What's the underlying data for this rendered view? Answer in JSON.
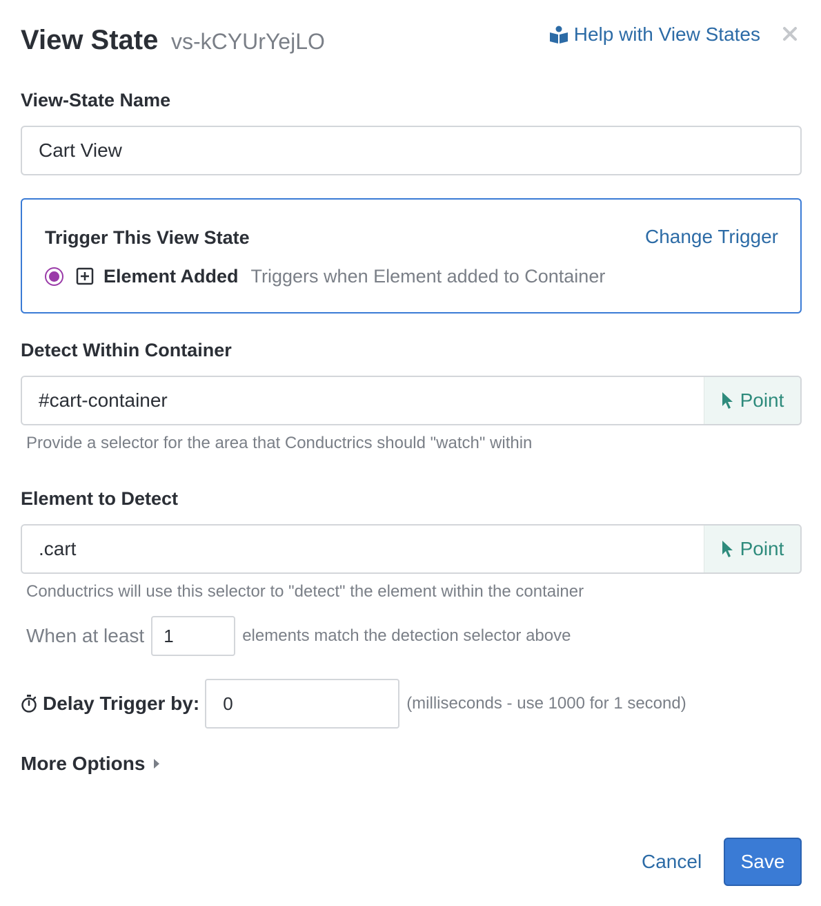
{
  "header": {
    "title": "View State",
    "id": "vs-kCYUrYejLO",
    "help_link": "Help with View States",
    "help_icon": "book-reader-icon",
    "close_icon": "close-icon"
  },
  "name_field": {
    "label": "View-State Name",
    "value": "Cart View"
  },
  "trigger": {
    "title": "Trigger This View State",
    "change_link": "Change Trigger",
    "name": "Element Added",
    "description": "Triggers when Element added to Container",
    "selected": true,
    "accent_color": "#9a3ba8"
  },
  "container_field": {
    "label": "Detect Within Container",
    "value": "#cart-container",
    "point_label": "Point",
    "help": "Provide a selector for the area that Conductrics should \"watch\" within"
  },
  "element_field": {
    "label": "Element to Detect",
    "value": ".cart",
    "point_label": "Point",
    "help": "Conductrics will use this selector to \"detect\" the element within the container"
  },
  "at_least": {
    "before": "When at least",
    "value": "1",
    "after": "elements match the detection selector above"
  },
  "delay": {
    "label": "Delay Trigger by:",
    "value": "0",
    "hint": "(milliseconds - use 1000 for 1 second)"
  },
  "more_options": "More Options",
  "footer": {
    "cancel": "Cancel",
    "save": "Save"
  },
  "colors": {
    "link": "#2c6ba6",
    "primary": "#3a7bd5",
    "point": "#2e8b7c"
  }
}
